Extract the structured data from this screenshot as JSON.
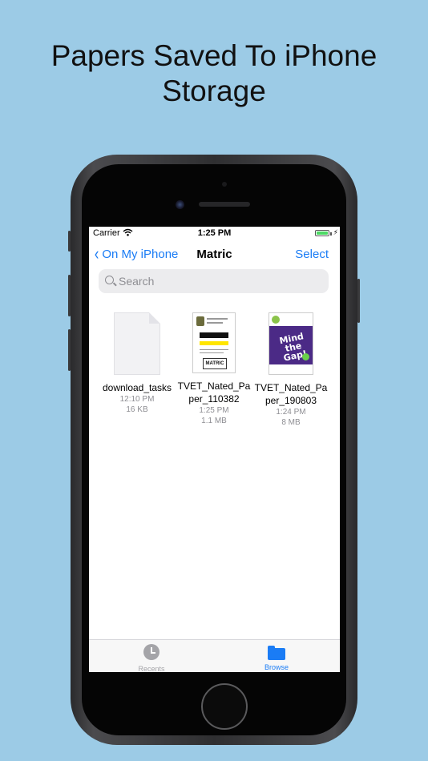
{
  "headline": "Papers Saved To iPhone Storage",
  "status_bar": {
    "carrier": "Carrier",
    "time": "1:25 PM"
  },
  "nav": {
    "back_label": "On My iPhone",
    "title": "Matric",
    "select_label": "Select"
  },
  "search": {
    "placeholder": "Search"
  },
  "files": [
    {
      "name": "download_tasks",
      "time": "12:10 PM",
      "size": "16 KB"
    },
    {
      "name": "TVET_Nated_Paper_110382",
      "time": "1:25 PM",
      "size": "1.1 MB"
    },
    {
      "name": "TVET_Nated_Paper_190803",
      "time": "1:24 PM",
      "size": "8 MB"
    }
  ],
  "thumbnails": {
    "matric_label": "MATRIC",
    "gap_title": "Mind the Gap!"
  },
  "tabbar": {
    "recents_label": "Recents",
    "browse_label": "Browse"
  },
  "colors": {
    "background": "#9ccbe6",
    "accent": "#1a7cf5",
    "inactive_tab": "#a4a4a8"
  }
}
